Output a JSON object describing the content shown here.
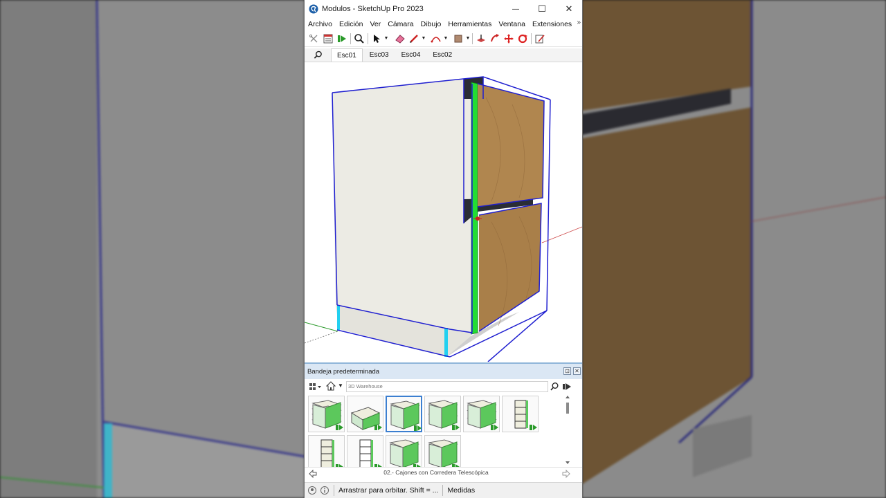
{
  "window": {
    "title": "Modulos - SketchUp Pro 2023",
    "minimize_glyph": "—",
    "maximize_glyph": "☐",
    "close_glyph": "✕"
  },
  "menu": {
    "items": [
      "Archivo",
      "Edición",
      "Ver",
      "Cámara",
      "Dibujo",
      "Herramientas",
      "Ventana",
      "Extensiones"
    ],
    "more_glyph": "»"
  },
  "scene_tabs": [
    "Esc01",
    "Esc03",
    "Esc04",
    "Esc02"
  ],
  "active_scene_tab": 0,
  "tray": {
    "title": "Bandeja predeterminada",
    "pin_glyph": "⊡",
    "close_glyph": "✕",
    "search_placeholder": "3D Warehouse",
    "folder_name": "02.- Cajones con Corredera Telescópica",
    "selected_component": 2
  },
  "status": {
    "message": "Arrastrar para orbitar. Shift = ...",
    "measure_label": "Medidas"
  },
  "colors": {
    "model_edges": "#1f1fd0",
    "panel_white": "#ecebe4",
    "wood": "#b0864f",
    "green_edge": "#22dd33",
    "cyan_edge": "#22d0f0",
    "dark_panel": "#2a2d35",
    "selection_blue": "#3c7fd0"
  }
}
